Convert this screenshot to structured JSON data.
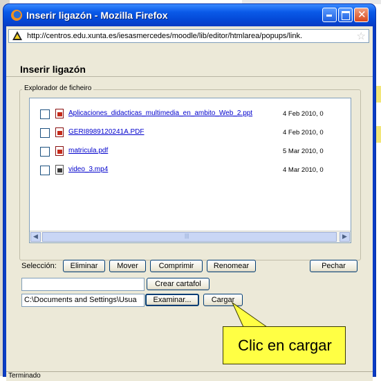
{
  "window": {
    "title": "Inserir ligazón - Mozilla Firefox",
    "url": "http://centros.edu.xunta.es/iesasmercedes/moodle/lib/editor/htmlarea/popups/link."
  },
  "dialog": {
    "title": "Inserir ligazón",
    "browser_legend": "Explorador de ficheiro",
    "files": [
      {
        "name": "Aplicaciones_didacticas_multimedia_en_ambito_Web_2.ppt",
        "date": "4 Feb 2010, 0",
        "icon": "ppt-file-icon"
      },
      {
        "name": "GERI8989120241A.PDF",
        "date": "4 Feb 2010, 0",
        "icon": "pdf-file-icon"
      },
      {
        "name": "matricula.pdf",
        "date": "5 Mar 2010, 0",
        "icon": "pdf-file-icon"
      },
      {
        "name": "video_3.mp4",
        "date": "4 Mar 2010, 0",
        "icon": "video-file-icon"
      }
    ],
    "selection_label": "Selección:",
    "buttons": {
      "delete": "Eliminar",
      "move": "Mover",
      "compress": "Comprimir",
      "rename": "Renomear",
      "close": "Pechar",
      "create_folder": "Crear cartafol",
      "browse": "Examinar...",
      "upload": "Cargar"
    },
    "folder_input_value": "",
    "file_path_value": "C:\\Documents and Settings\\Usua"
  },
  "callout": {
    "text": "Clic en cargar"
  },
  "status": {
    "text": "Terminado"
  },
  "colors": {
    "titlebar": "#0a5ae8",
    "callout": "#ffff44",
    "link": "#0000cc"
  }
}
